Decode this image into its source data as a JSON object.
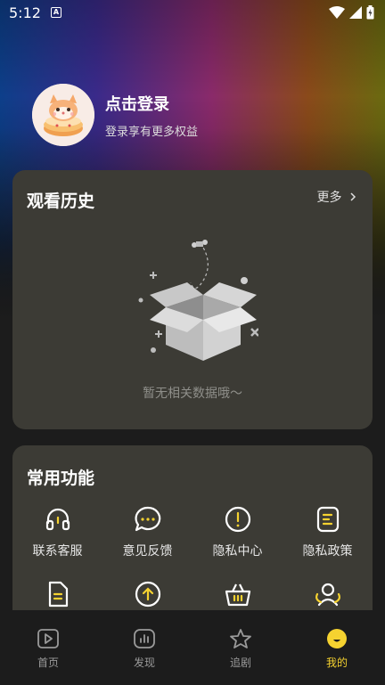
{
  "status_bar": {
    "time": "5:12",
    "notification_glyph": "A"
  },
  "profile": {
    "title": "点击登录",
    "subtitle": "登录享有更多权益"
  },
  "history": {
    "title": "观看历史",
    "more_label": "更多",
    "empty_text": "暂无相关数据哦～"
  },
  "functions": {
    "title": "常用功能",
    "items": [
      {
        "label": "联系客服",
        "icon": "headset-icon"
      },
      {
        "label": "意见反馈",
        "icon": "chat-bubble-icon"
      },
      {
        "label": "隐私中心",
        "icon": "alert-circle-icon"
      },
      {
        "label": "隐私政策",
        "icon": "document-lines-icon"
      },
      {
        "label": "",
        "icon": "document-icon"
      },
      {
        "label": "",
        "icon": "upload-circle-icon"
      },
      {
        "label": "",
        "icon": "basket-icon"
      },
      {
        "label": "",
        "icon": "users-icon"
      }
    ]
  },
  "tabbar": {
    "tabs": [
      {
        "label": "首页",
        "icon": "play-square-icon"
      },
      {
        "label": "发现",
        "icon": "chart-square-icon"
      },
      {
        "label": "追剧",
        "icon": "star-icon"
      },
      {
        "label": "我的",
        "icon": "smile-face-icon",
        "active": true
      }
    ]
  },
  "colors": {
    "accent": "#f5d230",
    "card": "#3c3b35",
    "background": "#1c1c1c"
  }
}
